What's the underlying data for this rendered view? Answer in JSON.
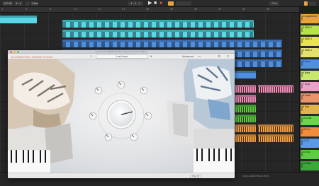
{
  "transport": {
    "tempo": "120.00",
    "meter": "4 / 4",
    "position": "1 . 1 . 1",
    "bars": "1 Bar",
    "cpu": "0 %"
  },
  "ruler": {
    "ticks": [
      "1",
      "5",
      "9",
      "13",
      "17",
      "21",
      "25",
      "29",
      "33",
      "37",
      "41",
      "45"
    ]
  },
  "tracks": [
    {
      "name": "1 Augmented",
      "color": "#e8a33c"
    },
    {
      "name": "2 MIDI 2",
      "color": "#b7e24a"
    },
    {
      "name": "3 MIDI 3",
      "color": "#e9e34c"
    },
    {
      "name": "4 MIDI 4",
      "color": "#e6e06e"
    },
    {
      "name": "5 Drum",
      "color": "#4f8fe0"
    },
    {
      "name": "6 Bass",
      "color": "#c7e86a"
    },
    {
      "name": "7 Keys",
      "color": "#f0a0c8"
    },
    {
      "name": "8 Audio",
      "color": "#e8946a"
    },
    {
      "name": "9 Pad",
      "color": "#e4b24a"
    },
    {
      "name": "10 Lead",
      "color": "#6fd24c"
    },
    {
      "name": "11 Perc",
      "color": "#f08c3c"
    },
    {
      "name": "12 FX",
      "color": "#5a9be8"
    },
    {
      "name": "13 Vox",
      "color": "#5dcc44"
    },
    {
      "name": "14 Main",
      "color": "#3aa83a"
    }
  ],
  "colors": {
    "midi_cyan": "#5ad7e6",
    "midi_blue": "#4f8fe0",
    "clip_pink": "#ee8fbf",
    "clip_orange": "#f0a04a",
    "clip_green": "#59cd46",
    "accent": "#e8a33c"
  },
  "plugin": {
    "title": "Augmented GRAND PIANO (Augmented Grand Piano)",
    "name": "AUGMENTED GRAND PIANO",
    "preset": "Lost Heart",
    "advanced_label": "Advanced",
    "footer_value": "Play All",
    "close_icon": "close-icon",
    "main_knob_label": "",
    "knobs": [
      {
        "label": ""
      },
      {
        "label": ""
      },
      {
        "label": ""
      },
      {
        "label": ""
      },
      {
        "label": ""
      },
      {
        "label": ""
      },
      {
        "label": ""
      }
    ]
  },
  "bottom": {
    "left": "",
    "right": "Drop Audio Effects Here"
  }
}
